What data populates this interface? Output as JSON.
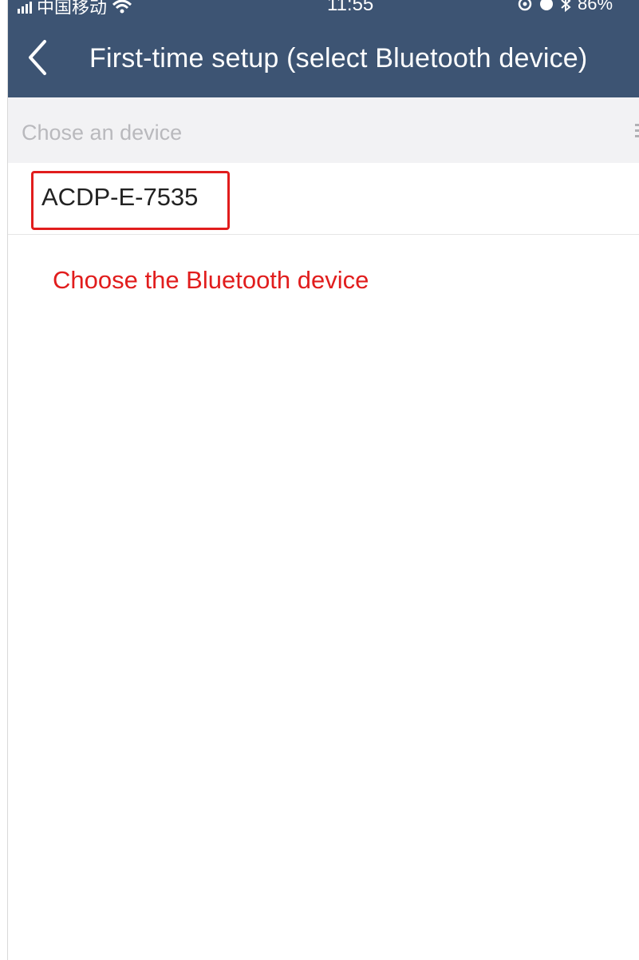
{
  "status_bar": {
    "carrier": "中国移动",
    "time": "11:55",
    "battery": "86%"
  },
  "header": {
    "title": "First-time setup (select Bluetooth device)",
    "back_icon": "chevron-left-icon"
  },
  "section": {
    "label": "Chose an device",
    "menu_icon": "menu-lines-icon"
  },
  "devices": [
    {
      "name": "ACDP-E-7535"
    }
  ],
  "annotation": {
    "text": "Choose the Bluetooth device"
  },
  "colors": {
    "header_bg": "#3d5473",
    "section_bg": "#f2f2f4",
    "highlight": "#e11d1d"
  }
}
